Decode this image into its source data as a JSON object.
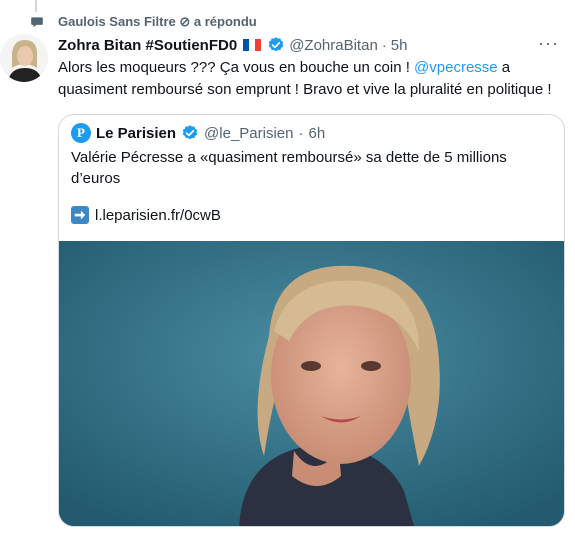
{
  "social_context": {
    "text": "Gaulois Sans Filtre ⊘ a répondu"
  },
  "tweet": {
    "display_name": "Zohra Bitan #SoutienFD0",
    "handle": "@ZohraBitan",
    "separator": "·",
    "time": "5h",
    "more": "···",
    "text_before": "Alors les moqueurs ??? Ça vous en bouche un coin ! ",
    "mention": "@vpecresse",
    "text_after": " a quasiment remboursé son emprunt ! Bravo et vive la pluralité en politique !"
  },
  "quote": {
    "logo_letter": "P",
    "display_name": "Le Parisien",
    "handle": "@le_Parisien",
    "separator": "·",
    "time": "6h",
    "text": "Valérie Pécresse a «quasiment remboursé» sa dette de 5 millions d’euros",
    "link_text": "l.leparisien.fr/0cwB"
  },
  "icons": {
    "reply": "speech-bubble-icon",
    "verified": "verified-badge-icon",
    "flag": "french-flag-icon",
    "link": "right-arrow-icon"
  },
  "colors": {
    "link": "#1d9bf0",
    "verified": "#1d9bf0",
    "secondary_text": "#536471",
    "image_background": "#2f6d83"
  }
}
